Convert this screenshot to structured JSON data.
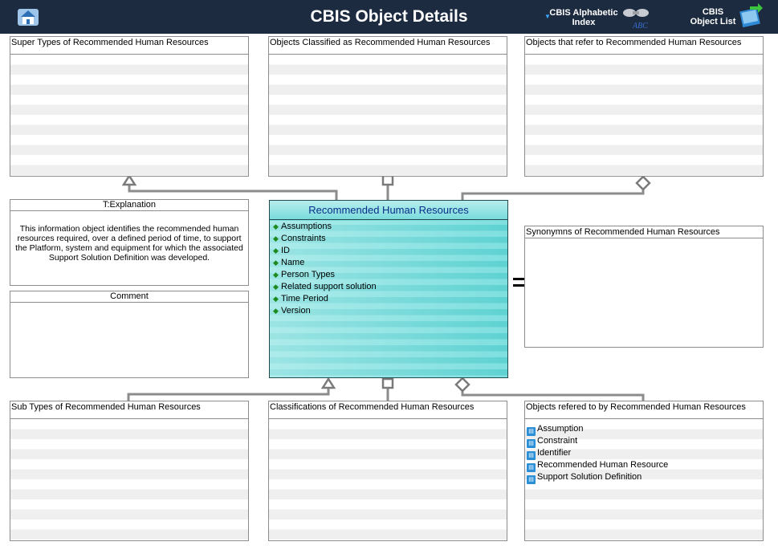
{
  "header": {
    "title": "CBIS Object Details",
    "alphabetic_index_label": "CBIS Alphabetic Index",
    "object_list_label": "CBIS Object List"
  },
  "panels": {
    "super_types": "Super Types of Recommended Human Resources",
    "classified_as": "Objects Classified as  Recommended Human Resources",
    "refer_to": "Objects that refer to    Recommended Human Resources",
    "explanation_title": "T:Explanation",
    "explanation_text": "This information object identifies the recommended human resources required, over a defined period of time,  to support the Platform, system and equipment for which the associated Support Solution Definition was developed.",
    "comment_title": "Comment",
    "synonyms": "Synonymns   of Recommended Human Resources",
    "sub_types": "Sub Types of Recommended Human Resources",
    "classifications": "Classifications of  Recommended Human Resources",
    "referred_by": "Objects refered to by    Recommended Human Resources"
  },
  "main_object": {
    "title": "Recommended Human Resources",
    "attributes": [
      "Assumptions",
      "Constraints",
      "ID",
      "Name",
      "Person Types",
      "Related support solution",
      "Time Period",
      "Version"
    ]
  },
  "referred_by_items": [
    "Assumption",
    "Constraint",
    "Identifier",
    "Recommended Human Resource",
    "Support Solution Definition"
  ],
  "colors": {
    "header": "#1c2b40",
    "object_fill": "#5fd2d2",
    "object_title": "#0a2d8a",
    "connector": "#8c8c8c"
  }
}
